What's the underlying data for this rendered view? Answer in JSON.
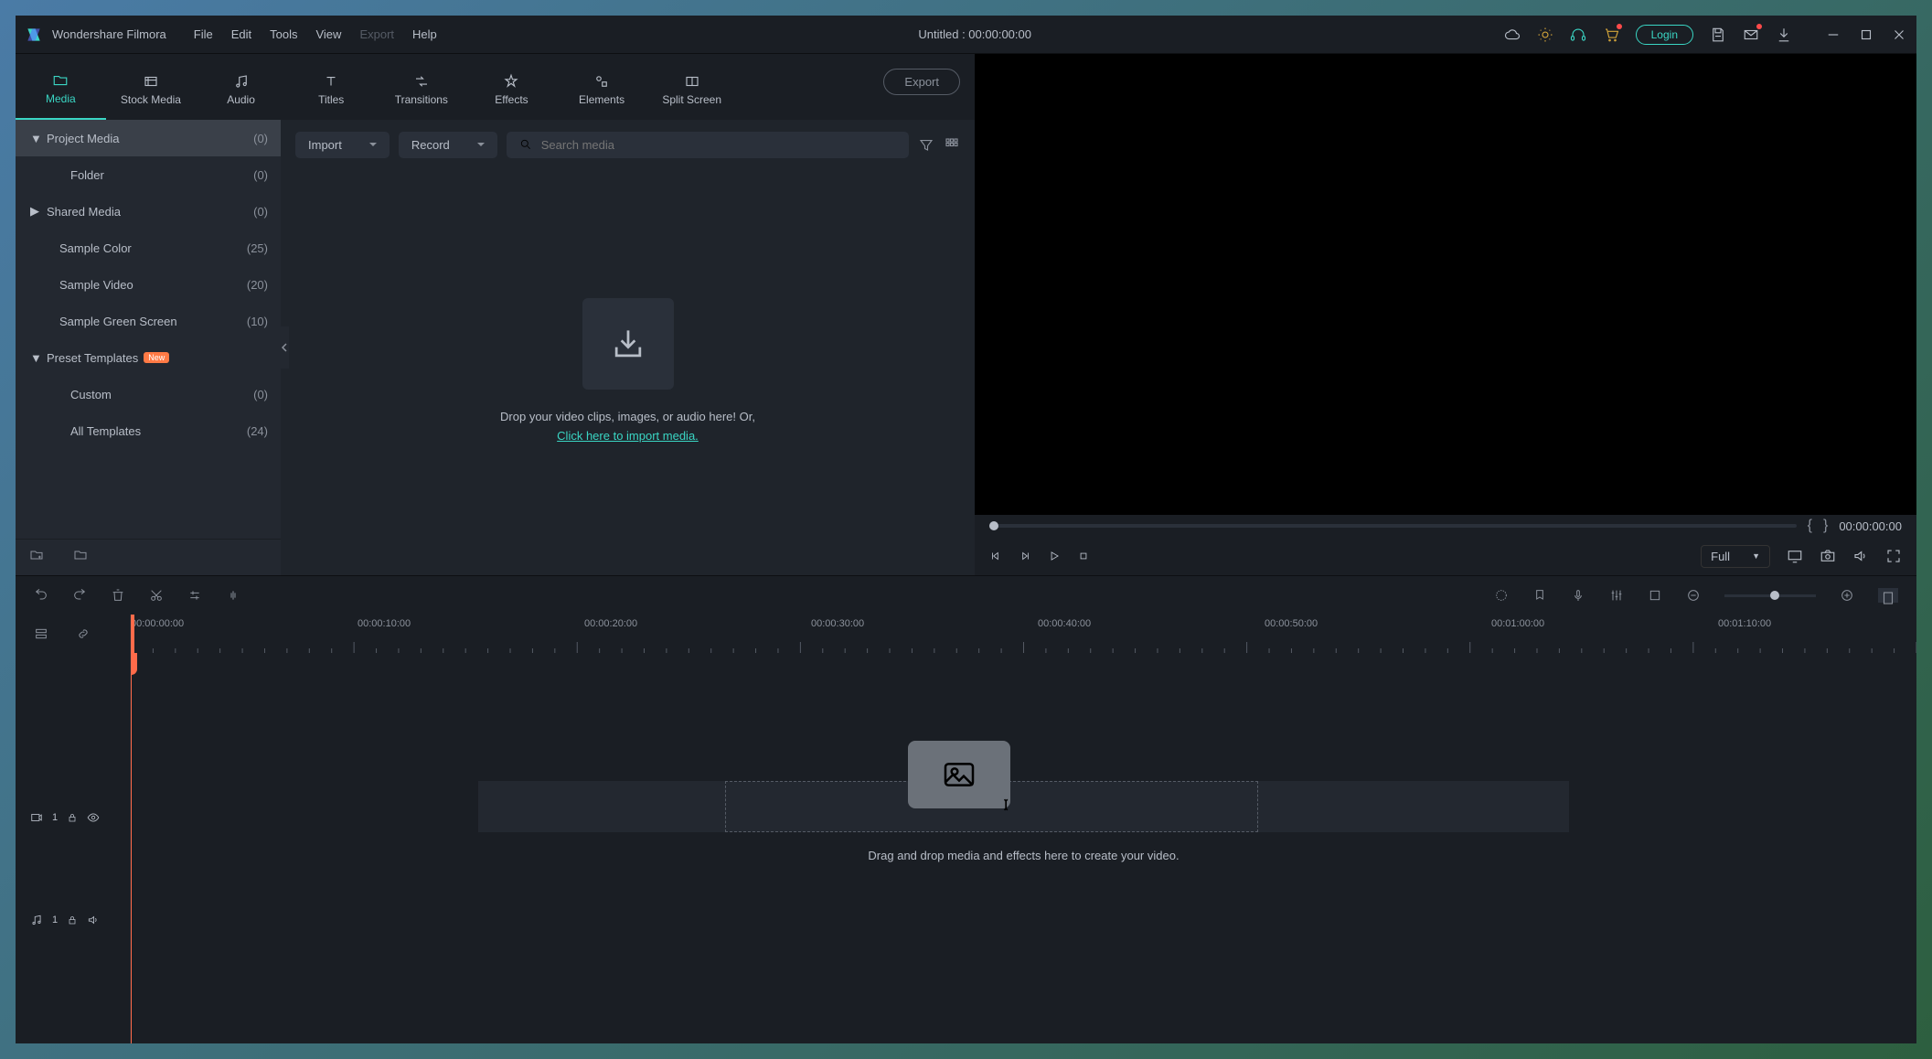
{
  "app_name": "Wondershare Filmora",
  "menus": {
    "file": "File",
    "edit": "Edit",
    "tools": "Tools",
    "view": "View",
    "export": "Export",
    "help": "Help"
  },
  "title": "Untitled : 00:00:00:00",
  "login": "Login",
  "tabs": {
    "media": "Media",
    "stock_media": "Stock Media",
    "audio": "Audio",
    "titles": "Titles",
    "transitions": "Transitions",
    "effects": "Effects",
    "elements": "Elements",
    "split_screen": "Split Screen"
  },
  "tree": {
    "project_media": {
      "label": "Project Media",
      "count": "(0)"
    },
    "folder": {
      "label": "Folder",
      "count": "(0)"
    },
    "shared_media": {
      "label": "Shared Media",
      "count": "(0)"
    },
    "sample_color": {
      "label": "Sample Color",
      "count": "(25)"
    },
    "sample_video": {
      "label": "Sample Video",
      "count": "(20)"
    },
    "sample_green": {
      "label": "Sample Green Screen",
      "count": "(10)"
    },
    "preset_templates": {
      "label": "Preset Templates",
      "badge": "New"
    },
    "custom": {
      "label": "Custom",
      "count": "(0)"
    },
    "all_templates": {
      "label": "All Templates",
      "count": "(24)"
    }
  },
  "toolbar": {
    "import": "Import",
    "record": "Record",
    "search_placeholder": "Search media",
    "export": "Export"
  },
  "drop_hint": {
    "line1": "Drop your video clips, images, or audio here! Or,",
    "link": "Click here to import media."
  },
  "preview": {
    "time": "00:00:00:00",
    "full": "Full"
  },
  "timeline": {
    "labels": [
      "00:00:00:00",
      "00:00:10:00",
      "00:00:20:00",
      "00:00:30:00",
      "00:00:40:00",
      "00:00:50:00",
      "00:01:00:00",
      "00:01:10:00"
    ],
    "video_track": "1",
    "audio_track": "1",
    "drop_text": "Drag and drop media and effects here to create your video."
  }
}
